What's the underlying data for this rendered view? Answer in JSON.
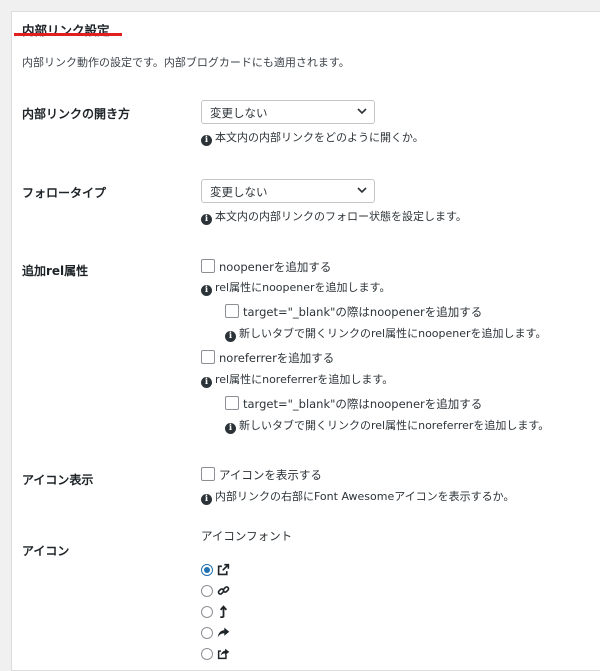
{
  "section": {
    "title": "内部リンク設定",
    "description": "内部リンク動作の設定です。内部ブログカードにも適用されます。"
  },
  "link_open": {
    "label": "内部リンクの開き方",
    "select_value": "変更しない",
    "help": "本文内の内部リンクをどのように開くか。"
  },
  "follow_type": {
    "label": "フォロータイプ",
    "select_value": "変更しない",
    "help": "本文内の内部リンクのフォロー状態を設定します。"
  },
  "rel": {
    "label": "追加rel属性",
    "noopener": {
      "checkbox": "noopenerを追加する",
      "checked": false,
      "help": "rel属性にnoopenerを追加します。",
      "sub_checkbox": "target=\"_blank\"の際はnoopenerを追加する",
      "sub_checked": false,
      "sub_help": "新しいタブで開くリンクのrel属性にnoopenerを追加します。"
    },
    "noreferrer": {
      "checkbox": "noreferrerを追加する",
      "checked": false,
      "help": "rel属性にnoreferrerを追加します。",
      "sub_checkbox": "target=\"_blank\"の際はnoopenerを追加する",
      "sub_checked": false,
      "sub_help": "新しいタブで開くリンクのrel属性にnoreferrerを追加します。"
    }
  },
  "icon_display": {
    "label": "アイコン表示",
    "checkbox": "アイコンを表示する",
    "checked": false,
    "help": "内部リンクの右部にFont Awesomeアイコンを表示するか。"
  },
  "icon": {
    "label": "アイコン",
    "sublabel": "アイコンフォント",
    "options": [
      {
        "icon": "external-link-icon",
        "selected": true
      },
      {
        "icon": "link-icon",
        "selected": false
      },
      {
        "icon": "level-up-icon",
        "selected": false
      },
      {
        "icon": "share-arrow-icon",
        "selected": false
      },
      {
        "icon": "share-square-icon",
        "selected": false
      }
    ]
  },
  "colors": {
    "accent_underline": "#e21f1f",
    "radio_selected": "#2271b1"
  }
}
